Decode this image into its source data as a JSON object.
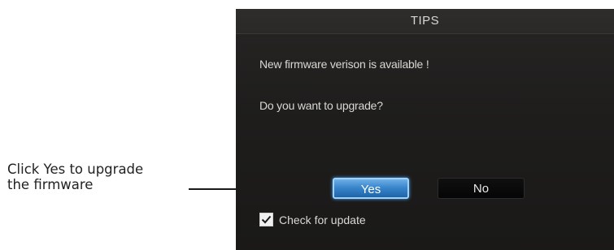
{
  "callout": {
    "line1": "Click Yes to upgrade",
    "line2": "the firmware"
  },
  "dialog": {
    "title": "TIPS",
    "message1": "New firmware verison is available !",
    "message2": "Do you want to upgrade?",
    "yes_label": "Yes",
    "no_label": "No",
    "checkbox_label": "Check for update",
    "checkbox_checked": true
  },
  "colors": {
    "dialog_bg": "#1e1d1c",
    "yes_button": "#3a86cc",
    "no_button": "#050505",
    "text": "#d9d8d4"
  },
  "icons": {
    "checkbox": "checkmark-icon"
  }
}
